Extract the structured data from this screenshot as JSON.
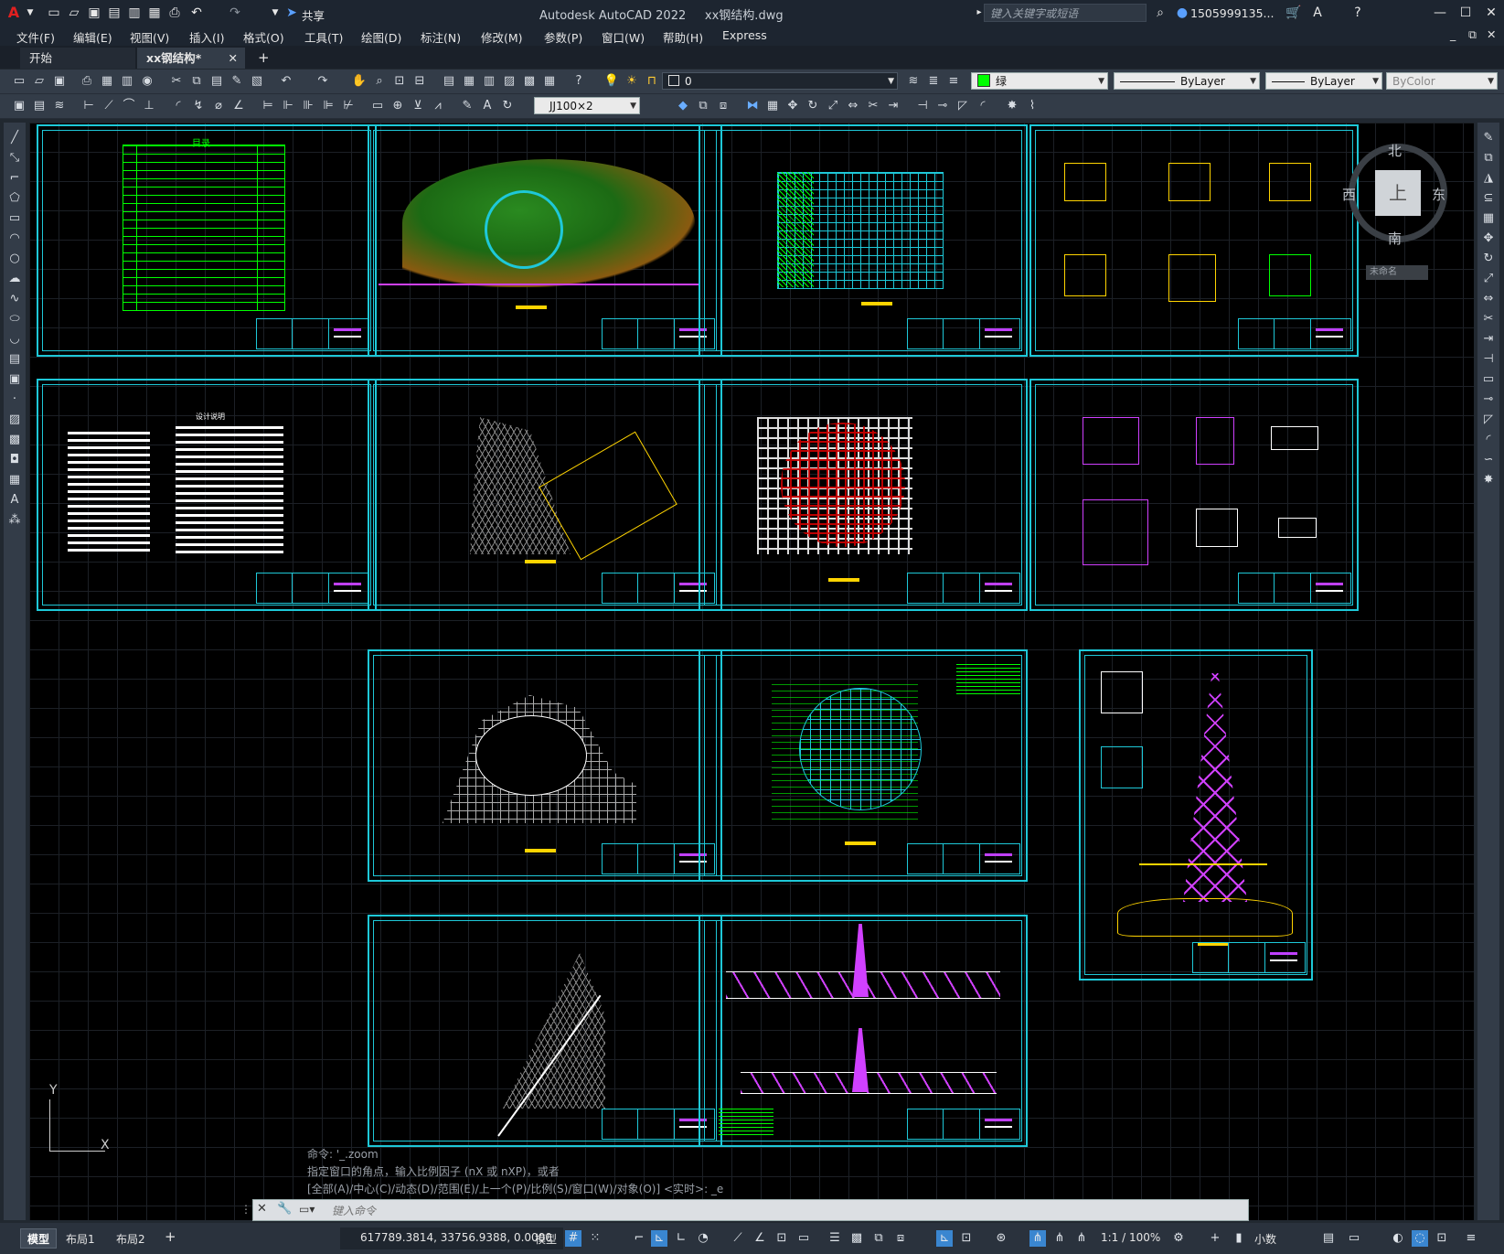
{
  "app": {
    "title": "Autodesk AutoCAD 2022",
    "file": "xx钢结构.dwg",
    "logo": "A"
  },
  "quick_access": {
    "share_label": "共享",
    "icons": [
      "new-icon",
      "open-icon",
      "save-icon",
      "save-as-icon",
      "plot-icon",
      "undo-icon",
      "redo-icon"
    ]
  },
  "search": {
    "placeholder": "键入关键字或短语"
  },
  "user": {
    "name": "1505999135..."
  },
  "menu": [
    "文件(F)",
    "编辑(E)",
    "视图(V)",
    "插入(I)",
    "格式(O)",
    "工具(T)",
    "绘图(D)",
    "标注(N)",
    "修改(M)",
    "参数(P)",
    "窗口(W)",
    "帮助(H)",
    "Express"
  ],
  "tabs": [
    {
      "label": "开始"
    },
    {
      "label": "xx钢结构*",
      "active": true
    }
  ],
  "toolbar": {
    "layer_value": "0",
    "color_value": "绿",
    "linetype_value": "ByLayer",
    "lineweight_value": "ByLayer",
    "plotstyle_value": "ByColor",
    "dimstyle_value": "JJ100×2"
  },
  "viewcube": {
    "north": "北",
    "south": "南",
    "east": "东",
    "west": "西",
    "top": "上",
    "wcs": "未命名"
  },
  "ucs": {
    "y_label": "Y",
    "x_label": "X"
  },
  "command": {
    "history": [
      "命令: '_.zoom",
      "指定窗口的角点，输入比例因子 (nX 或 nXP)，或者",
      "[全部(A)/中心(C)/动态(D)/范围(E)/上一个(P)/比例(S)/窗口(W)/对象(O)] <实时>: _e"
    ],
    "placeholder": "键入命令"
  },
  "layout_tabs": [
    "模型",
    "布局1",
    "布局2"
  ],
  "status": {
    "coords": "617789.3814, 33756.9388, 0.0000",
    "space": "模型",
    "scale": "1:1 / 100%",
    "units": "小数"
  },
  "drawing": {
    "toc_title": "目录",
    "notes_title": "设计说明"
  },
  "colors": {
    "frame": "#1ec8d8",
    "green": "#00ff00",
    "yellow": "#ffd400",
    "magenta": "#d040ff",
    "red": "#d00000"
  }
}
